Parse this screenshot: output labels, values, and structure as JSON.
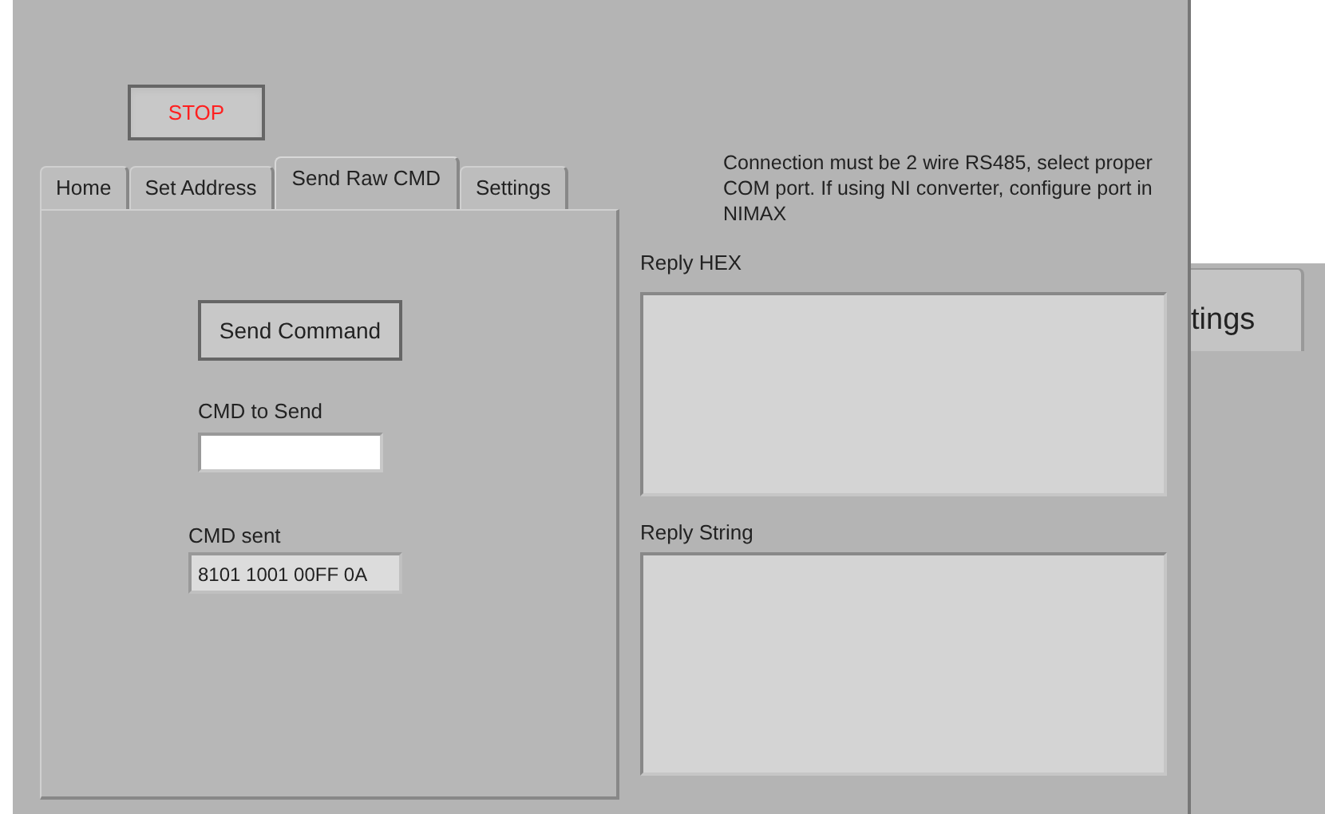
{
  "stop_button": {
    "label": "STOP"
  },
  "tabs": [
    {
      "label": "Home",
      "selected": false
    },
    {
      "label": "Set Address",
      "selected": false
    },
    {
      "label": "Send Raw CMD",
      "selected": true
    },
    {
      "label": "Settings",
      "selected": false
    }
  ],
  "send_button": {
    "label": "Send Command"
  },
  "cmd_to_send": {
    "label": "CMD to Send"
  },
  "cmd_sent": {
    "label": "CMD sent",
    "value": "8101 1001 00FF 0A"
  },
  "note": "Connection must be 2 wire RS485, select proper COM port. If using NI converter, configure port in NIMAX",
  "reply_hex": {
    "label": "Reply HEX"
  },
  "reply_string": {
    "label": "Reply String"
  },
  "background_window": {
    "tab": "tings"
  }
}
